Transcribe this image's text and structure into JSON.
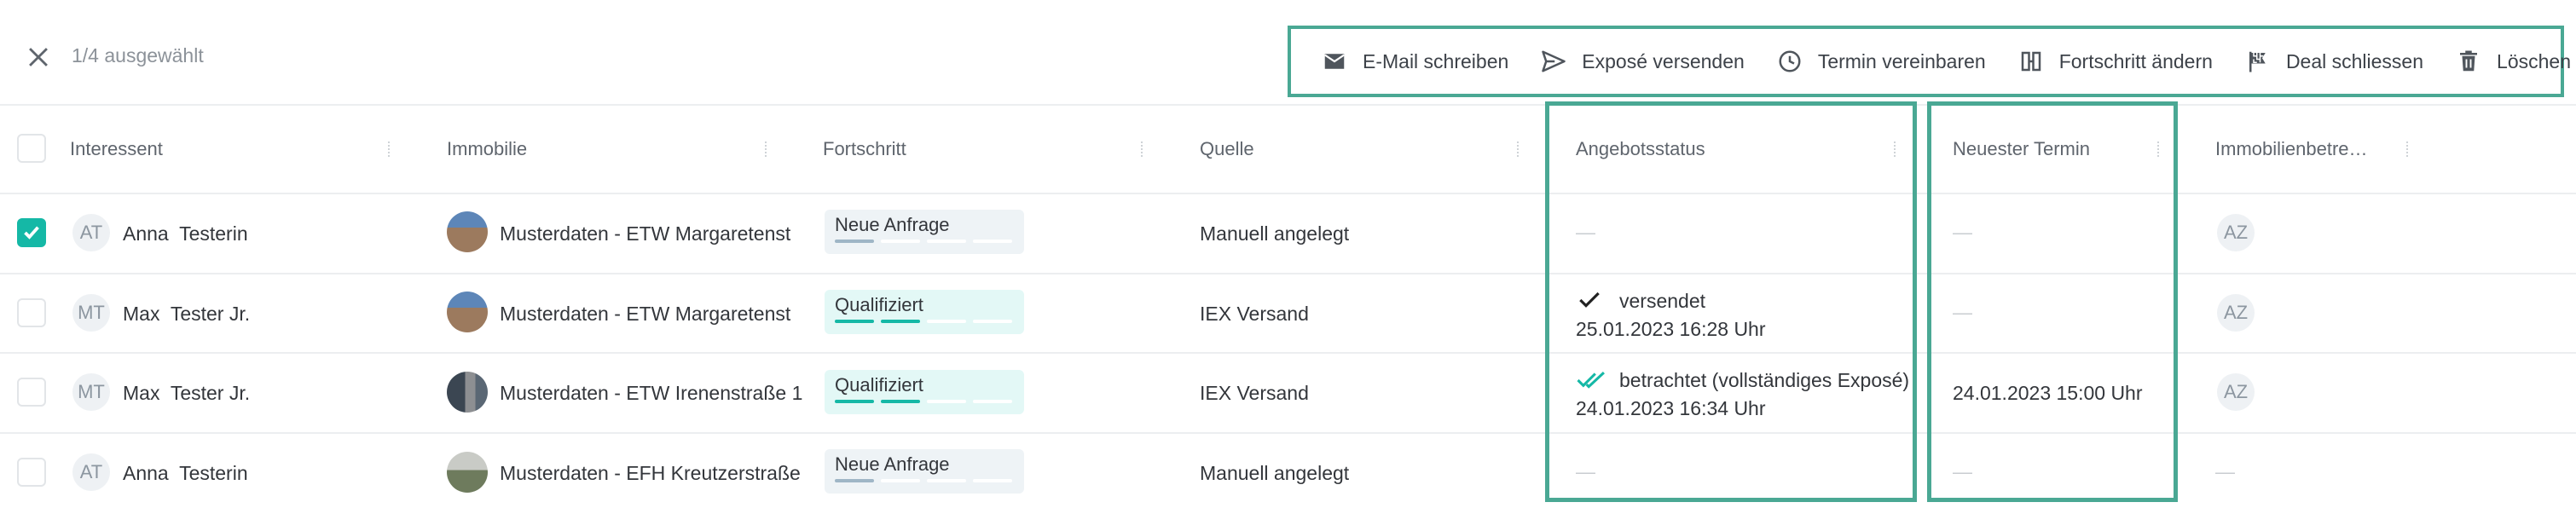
{
  "selection": {
    "count_label": "1/4 ausgewählt"
  },
  "actions": [
    {
      "label": "E-Mail schreiben",
      "icon": "mail-icon"
    },
    {
      "label": "Exposé versenden",
      "icon": "send-icon"
    },
    {
      "label": "Termin vereinbaren",
      "icon": "clock-icon"
    },
    {
      "label": "Fortschritt ändern",
      "icon": "progress-icon"
    },
    {
      "label": "Deal schliessen",
      "icon": "flag-icon"
    },
    {
      "label": "Löschen",
      "icon": "trash-icon"
    }
  ],
  "columns": [
    "Interessent",
    "Immobilie",
    "Fortschritt",
    "Quelle",
    "Angebotsstatus",
    "Neuester Termin",
    "Immobilienbetre…"
  ],
  "rows": [
    {
      "checked": true,
      "initials": "AT",
      "interessent": "Anna  Testerin",
      "immobilie": "Musterdaten - ETW Margaretenst",
      "fortschritt": "Neue Anfrage",
      "quelle": "Manuell angelegt",
      "angebotsstatus": "—",
      "angebot_datum": "",
      "termin": "—",
      "betreuer": "AZ"
    },
    {
      "checked": false,
      "initials": "MT",
      "interessent": "Max  Tester Jr.",
      "immobilie": "Musterdaten - ETW Margaretenst",
      "fortschritt": "Qualifiziert",
      "quelle": "IEX Versand",
      "angebotsstatus": "versendet",
      "angebot_datum": "25.01.2023 16:28 Uhr",
      "termin": "—",
      "betreuer": "AZ"
    },
    {
      "checked": false,
      "initials": "MT",
      "interessent": "Max  Tester Jr.",
      "immobilie": "Musterdaten - ETW Irenenstraße 1",
      "fortschritt": "Qualifiziert",
      "quelle": "IEX Versand",
      "angebotsstatus": "betrachtet (vollständiges Exposé)",
      "angebot_datum": "24.01.2023 16:34 Uhr",
      "termin": "24.01.2023 15:00 Uhr",
      "betreuer": "AZ"
    },
    {
      "checked": false,
      "initials": "AT",
      "interessent": "Anna  Testerin",
      "immobilie": "Musterdaten - EFH Kreutzerstraße",
      "fortschritt": "Neue Anfrage",
      "quelle": "Manuell angelegt",
      "angebotsstatus": "—",
      "angebot_datum": "",
      "termin": "—",
      "betreuer": "—"
    }
  ],
  "colors": {
    "accent": "#15b8a6",
    "highlight_border": "#4aa894",
    "neue_anfrage_bg": "#eef3f6",
    "qualifiziert_bg": "#e3f8f6"
  }
}
